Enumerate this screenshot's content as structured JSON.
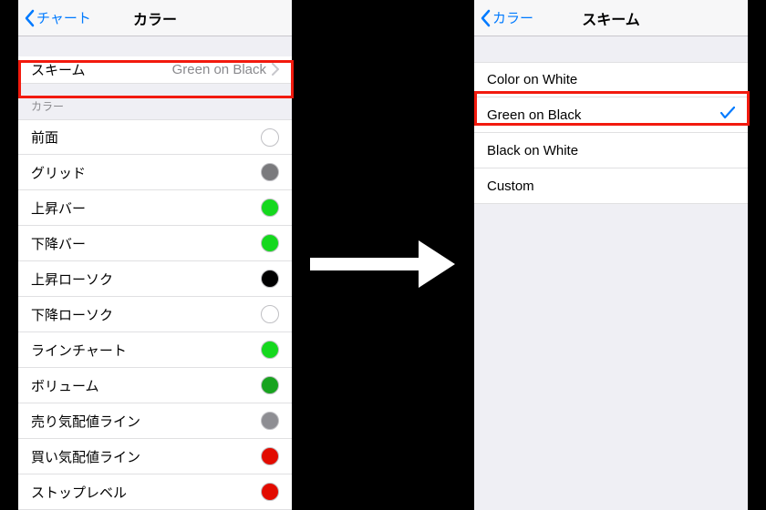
{
  "left": {
    "backLabel": "チャート",
    "title": "カラー",
    "schemeRow": {
      "label": "スキーム",
      "value": "Green on Black"
    },
    "colorHeader": "カラー",
    "colorItems": [
      {
        "label": "前面",
        "color": "#ffffff",
        "borderOnly": true
      },
      {
        "label": "グリッド",
        "color": "#7a7a7d"
      },
      {
        "label": "上昇バー",
        "color": "#15d81e"
      },
      {
        "label": "下降バー",
        "color": "#15d81e"
      },
      {
        "label": "上昇ローソク",
        "color": "#000000"
      },
      {
        "label": "下降ローソク",
        "color": "#ffffff",
        "borderOnly": true
      },
      {
        "label": "ラインチャート",
        "color": "#15d81e"
      },
      {
        "label": "ボリューム",
        "color": "#18a31f"
      },
      {
        "label": "売り気配値ライン",
        "color": "#8e8e93"
      },
      {
        "label": "買い気配値ライン",
        "color": "#e20b00"
      },
      {
        "label": "ストップレベル",
        "color": "#e20b00"
      }
    ]
  },
  "right": {
    "backLabel": "カラー",
    "title": "スキーム",
    "options": [
      {
        "label": "Color on White",
        "selected": false
      },
      {
        "label": "Green on Black",
        "selected": true
      },
      {
        "label": "Black on White",
        "selected": false
      },
      {
        "label": "Custom",
        "selected": false
      }
    ]
  }
}
